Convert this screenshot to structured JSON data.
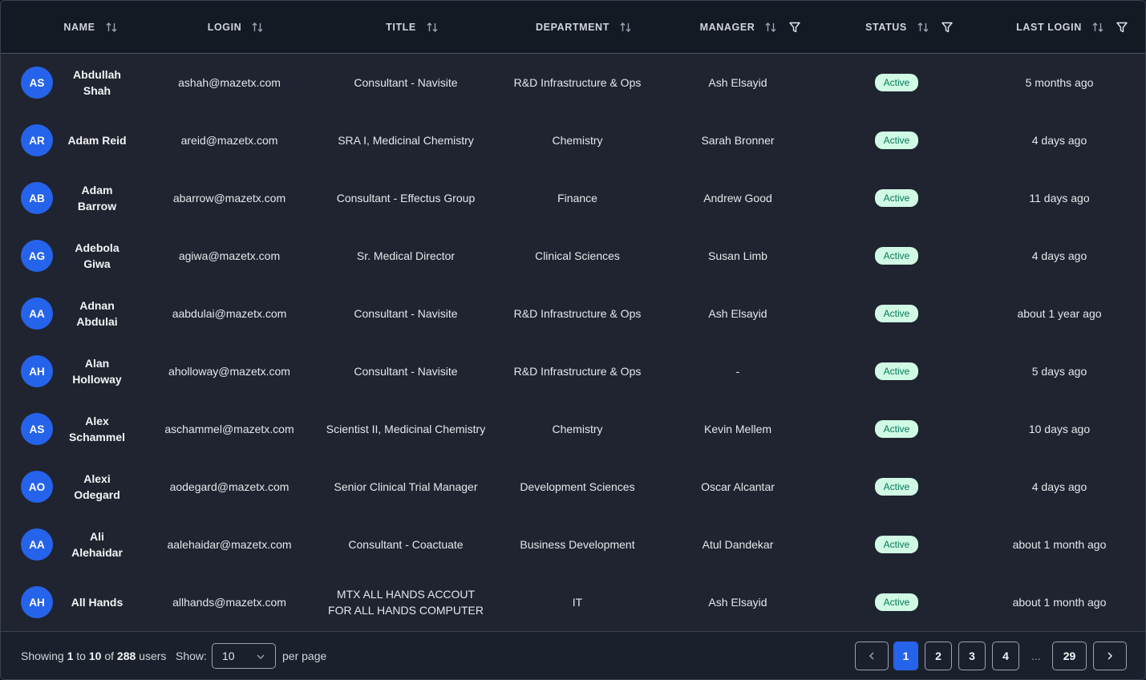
{
  "columns": [
    {
      "label": "NAME",
      "sortable": true,
      "filterable": false
    },
    {
      "label": "LOGIN",
      "sortable": true,
      "filterable": false
    },
    {
      "label": "TITLE",
      "sortable": true,
      "filterable": false
    },
    {
      "label": "DEPARTMENT",
      "sortable": true,
      "filterable": false
    },
    {
      "label": "MANAGER",
      "sortable": true,
      "filterable": true
    },
    {
      "label": "STATUS",
      "sortable": true,
      "filterable": true
    },
    {
      "label": "LAST LOGIN",
      "sortable": true,
      "filterable": true
    }
  ],
  "rows": [
    {
      "initials": "AS",
      "name": "Abdullah Shah",
      "login": "ashah@mazetx.com",
      "title": "Consultant - Navisite",
      "department": "R&D Infrastructure & Ops",
      "manager": "Ash Elsayid",
      "status": "Active",
      "last_login": "5 months ago"
    },
    {
      "initials": "AR",
      "name": "Adam Reid",
      "login": "areid@mazetx.com",
      "title": "SRA I, Medicinal Chemistry",
      "department": "Chemistry",
      "manager": "Sarah Bronner",
      "status": "Active",
      "last_login": "4 days ago"
    },
    {
      "initials": "AB",
      "name": "Adam Barrow",
      "login": "abarrow@mazetx.com",
      "title": "Consultant - Effectus Group",
      "department": "Finance",
      "manager": "Andrew Good",
      "status": "Active",
      "last_login": "11 days ago"
    },
    {
      "initials": "AG",
      "name": "Adebola Giwa",
      "login": "agiwa@mazetx.com",
      "title": "Sr. Medical Director",
      "department": "Clinical Sciences",
      "manager": "Susan Limb",
      "status": "Active",
      "last_login": "4 days ago"
    },
    {
      "initials": "AA",
      "name": "Adnan Abdulai",
      "login": "aabdulai@mazetx.com",
      "title": "Consultant - Navisite",
      "department": "R&D Infrastructure & Ops",
      "manager": "Ash Elsayid",
      "status": "Active",
      "last_login": "about 1 year ago"
    },
    {
      "initials": "AH",
      "name": "Alan Holloway",
      "login": "aholloway@mazetx.com",
      "title": "Consultant - Navisite",
      "department": "R&D Infrastructure & Ops",
      "manager": "-",
      "status": "Active",
      "last_login": "5 days ago"
    },
    {
      "initials": "AS",
      "name": "Alex Schammel",
      "login": "aschammel@mazetx.com",
      "title": "Scientist II, Medicinal Chemistry",
      "department": "Chemistry",
      "manager": "Kevin Mellem",
      "status": "Active",
      "last_login": "10 days ago"
    },
    {
      "initials": "AO",
      "name": "Alexi Odegard",
      "login": "aodegard@mazetx.com",
      "title": "Senior Clinical Trial Manager",
      "department": "Development Sciences",
      "manager": "Oscar Alcantar",
      "status": "Active",
      "last_login": "4 days ago"
    },
    {
      "initials": "AA",
      "name": "Ali Alehaidar",
      "login": "aalehaidar@mazetx.com",
      "title": "Consultant - Coactuate",
      "department": "Business Development",
      "manager": "Atul Dandekar",
      "status": "Active",
      "last_login": "about 1 month ago"
    },
    {
      "initials": "AH",
      "name": "All Hands",
      "login": "allhands@mazetx.com",
      "title": "MTX ALL HANDS ACCOUT FOR ALL HANDS COMPUTER",
      "department": "IT",
      "manager": "Ash Elsayid",
      "status": "Active",
      "last_login": "about 1 month ago"
    }
  ],
  "footer": {
    "showing_prefix": "Showing",
    "from": "1",
    "to_word": "to",
    "to": "10",
    "of_word": "of",
    "total": "288",
    "unit": "users",
    "show_label": "Show:",
    "page_size": "10",
    "per_page_label": "per page"
  },
  "pagination": {
    "pages": [
      "1",
      "2",
      "3",
      "4"
    ],
    "ellipsis": "...",
    "last_page": "29",
    "current": "1"
  },
  "colors": {
    "accent": "#2563eb",
    "status_active_bg": "#d1fae5",
    "status_active_text": "#047857"
  }
}
